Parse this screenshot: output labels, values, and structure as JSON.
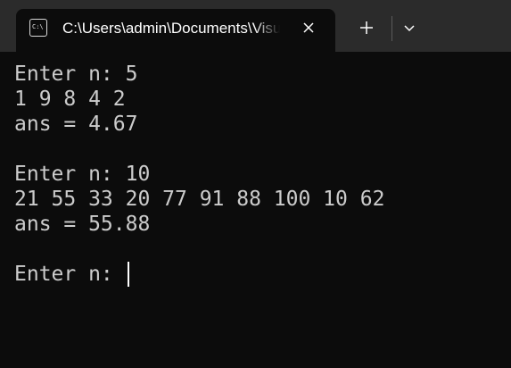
{
  "window": {
    "tab_title": "C:\\Users\\admin\\Documents\\Visual Studio",
    "tab_icon_text": "C:\\",
    "icons": {
      "tab": "terminal-icon",
      "close": "close-icon",
      "new_tab": "plus-icon",
      "dropdown": "chevron-down-icon"
    }
  },
  "terminal": {
    "lines": [
      "Enter n: 5",
      "1 9 8 4 2",
      "ans = 4.67",
      "",
      "Enter n: 10",
      "21 55 33 20 77 91 88 100 10 62",
      "ans = 55.88",
      "",
      "Enter n: "
    ],
    "text_color": "#cccccc",
    "background": "#0c0c0c"
  }
}
